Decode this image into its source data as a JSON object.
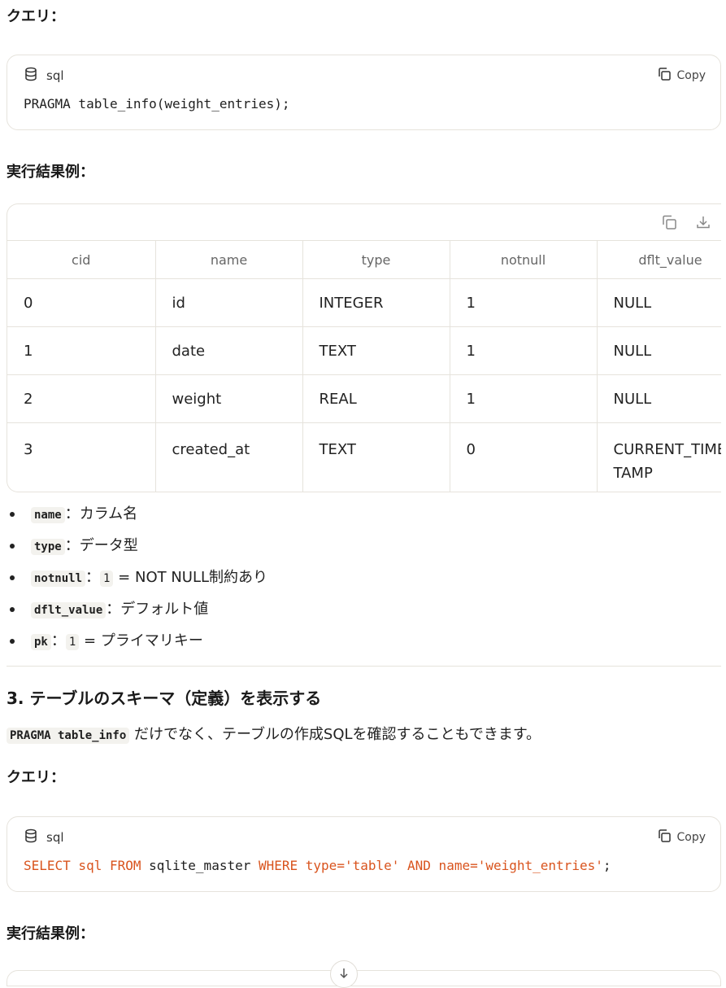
{
  "sections": {
    "query_label_1": "クエリ：",
    "result_label_1": "実行結果例：",
    "query_label_2": "クエリ：",
    "result_label_2": "実行結果例：",
    "heading_3": "3. テーブルのスキーマ（定義）を表示する"
  },
  "code1": {
    "lang": "sql",
    "copy_label": "Copy",
    "line": "PRAGMA table_info(weight_entries);"
  },
  "code2": {
    "lang": "sql",
    "copy_label": "Copy",
    "tokens": {
      "t1": "SELECT sql FROM ",
      "t2": "sqlite_master ",
      "t3": "WHERE type=",
      "t4": "'table'",
      "t5": " AND name=",
      "t6": "'weight_entries'",
      "t7": ";"
    }
  },
  "table": {
    "headers": [
      "cid",
      "name",
      "type",
      "notnull",
      "dflt_value"
    ],
    "rows": [
      [
        "0",
        "id",
        "INTEGER",
        "1",
        "NULL"
      ],
      [
        "1",
        "date",
        "TEXT",
        "1",
        "NULL"
      ],
      [
        "2",
        "weight",
        "REAL",
        "1",
        "NULL"
      ],
      [
        "3",
        "created_at",
        "TEXT",
        "0",
        "CURRENT_TIMESTAMP"
      ]
    ]
  },
  "bullets": [
    {
      "code": "name",
      "sep": "：",
      "text": "カラム名"
    },
    {
      "code": "type",
      "sep": "：",
      "text": "データ型"
    },
    {
      "code": "notnull",
      "sep": "：",
      "val": "1",
      "text": " = NOT NULL制約あり"
    },
    {
      "code": "dflt_value",
      "sep": "：",
      "text": "デフォルト値"
    },
    {
      "code": "pk",
      "sep": "：",
      "val": "1",
      "text": " = プライマリキー"
    }
  ],
  "para": {
    "code": "PRAGMA table_info",
    "text": " だけでなく、テーブルの作成SQLを確認することもできます。"
  },
  "icons": {
    "database": "database-icon",
    "copy": "copy-icon",
    "download": "download-icon",
    "scroll_down": "arrow-down-icon"
  },
  "colors": {
    "keyword": "#d9541e",
    "border": "#e6e3dc"
  }
}
